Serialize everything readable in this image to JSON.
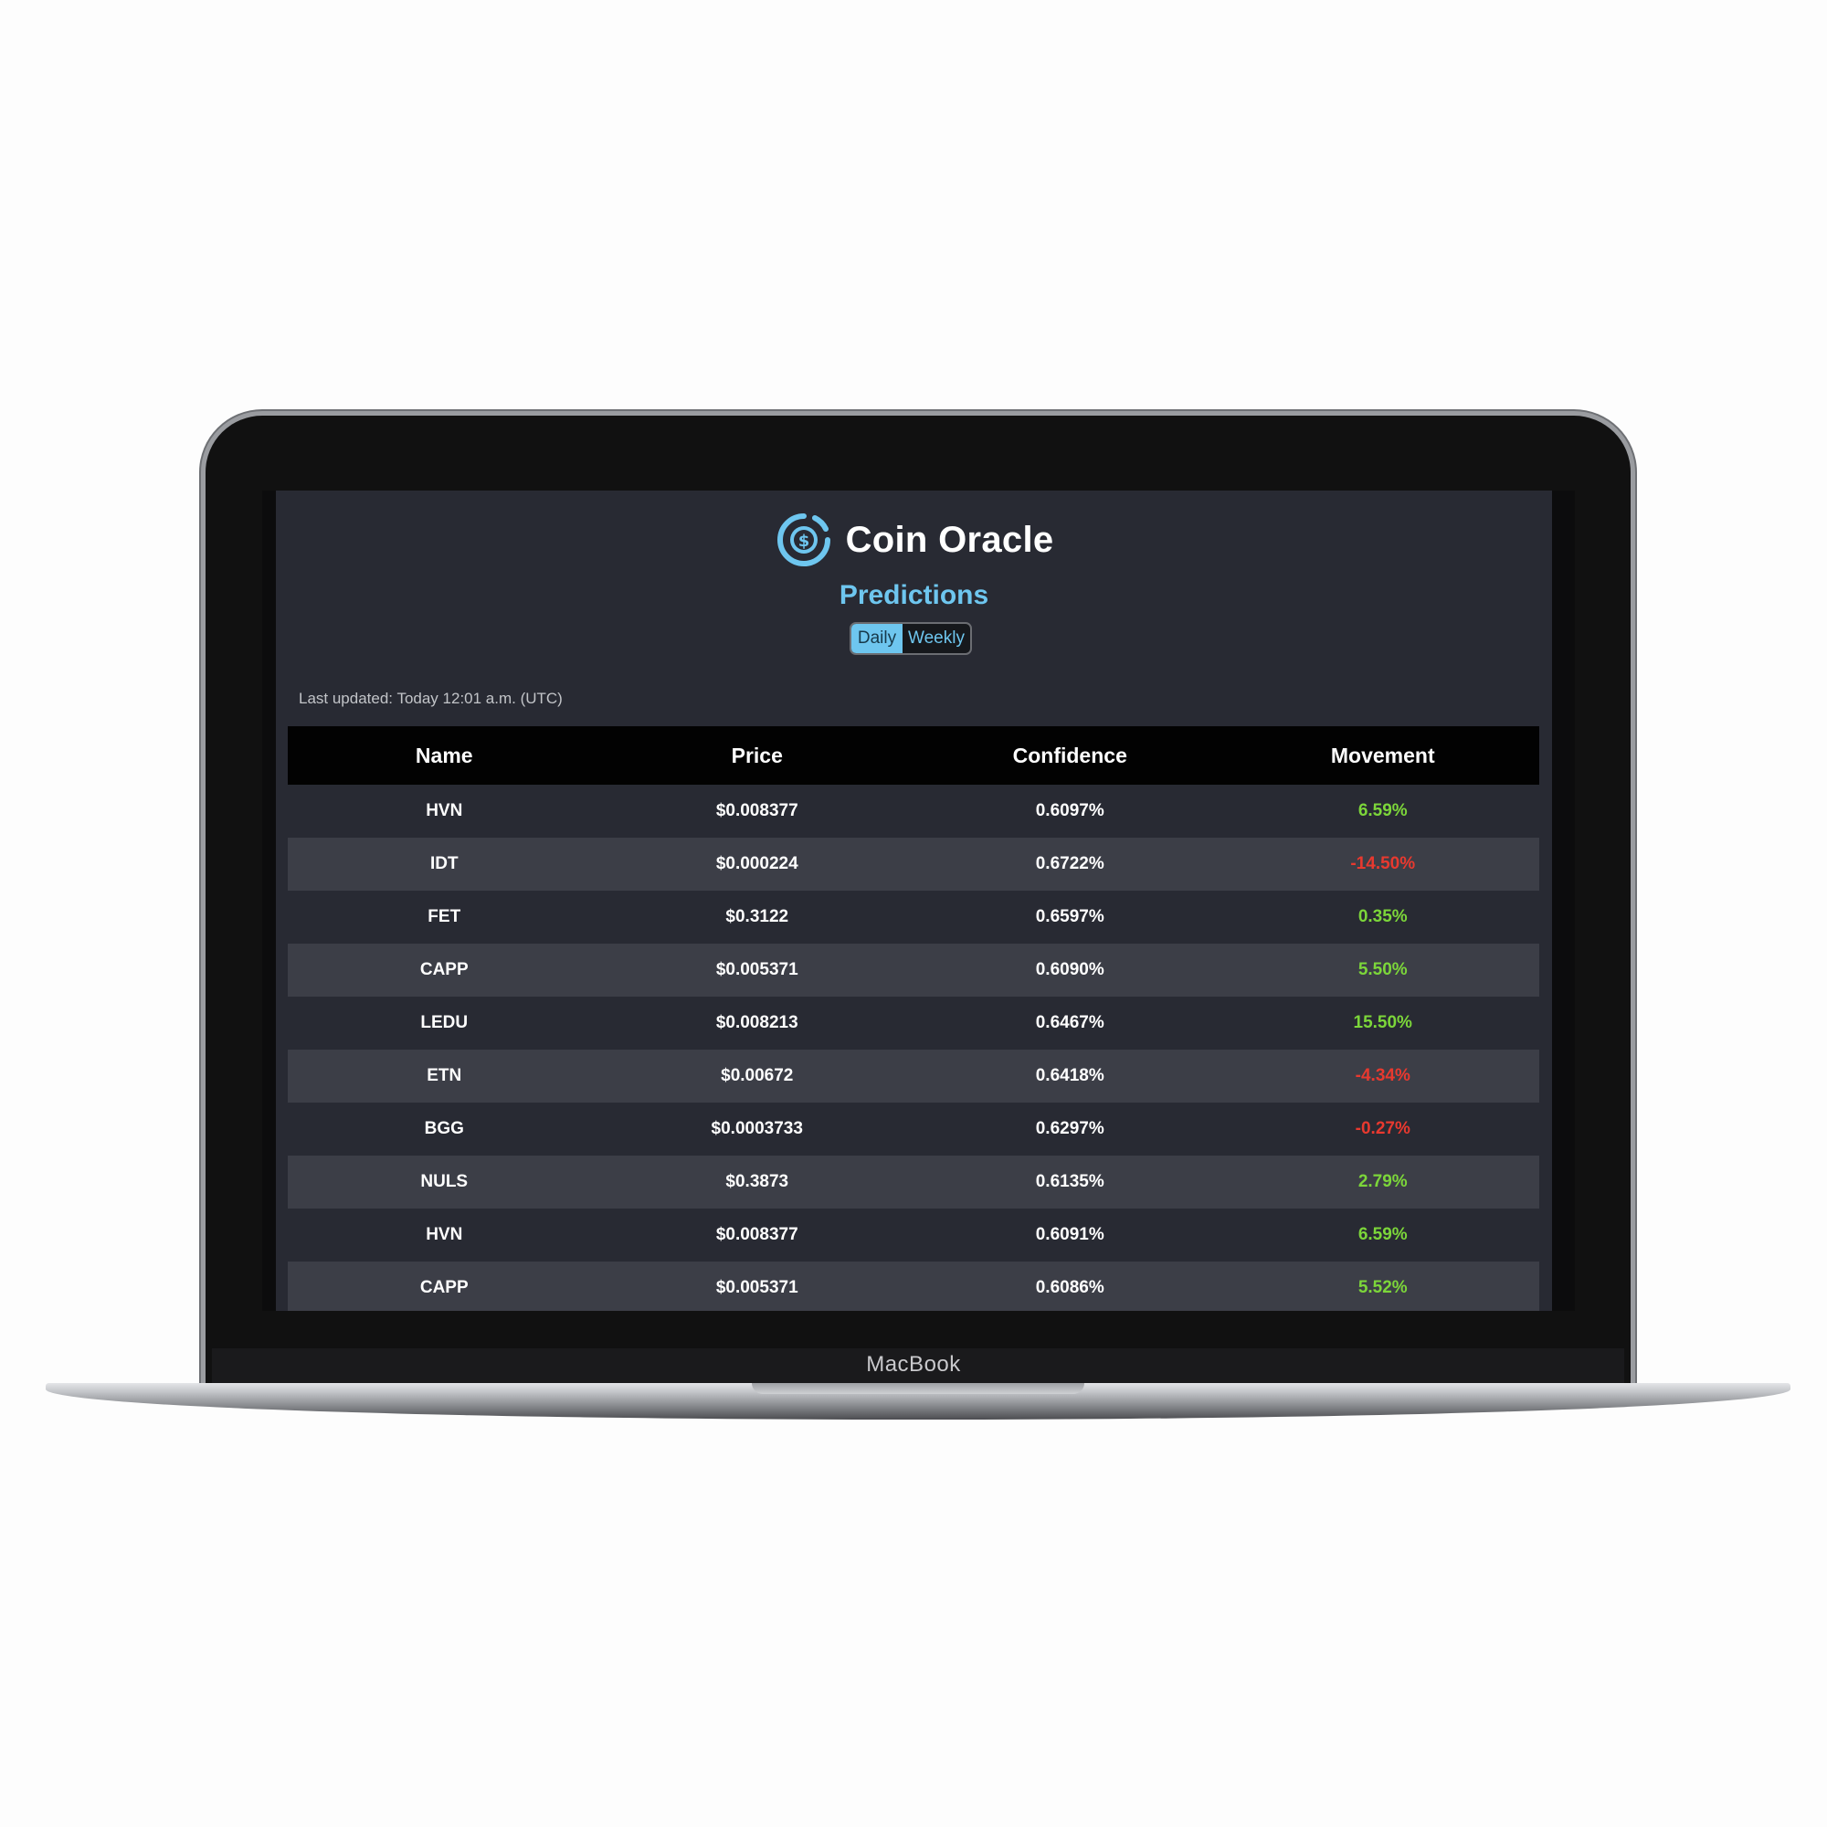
{
  "device": {
    "brand": "MacBook"
  },
  "header": {
    "app_title": "Coin Oracle",
    "logo_icon": "coin-dollar-icon",
    "accent_color": "#6ec6ef"
  },
  "page": {
    "title": "Predictions"
  },
  "period_toggle": {
    "options": [
      "Daily",
      "Weekly"
    ],
    "selected": "Daily"
  },
  "last_updated": "Last updated: Today 12:01 a.m. (UTC)",
  "table": {
    "columns": [
      "Name",
      "Price",
      "Confidence",
      "Movement"
    ],
    "rows": [
      {
        "name": "HVN",
        "price": "$0.008377",
        "confidence": "0.6097%",
        "movement": "6.59%",
        "direction": "up"
      },
      {
        "name": "IDT",
        "price": "$0.000224",
        "confidence": "0.6722%",
        "movement": "-14.50%",
        "direction": "down"
      },
      {
        "name": "FET",
        "price": "$0.3122",
        "confidence": "0.6597%",
        "movement": "0.35%",
        "direction": "up"
      },
      {
        "name": "CAPP",
        "price": "$0.005371",
        "confidence": "0.6090%",
        "movement": "5.50%",
        "direction": "up"
      },
      {
        "name": "LEDU",
        "price": "$0.008213",
        "confidence": "0.6467%",
        "movement": "15.50%",
        "direction": "up"
      },
      {
        "name": "ETN",
        "price": "$0.00672",
        "confidence": "0.6418%",
        "movement": "-4.34%",
        "direction": "down"
      },
      {
        "name": "BGG",
        "price": "$0.0003733",
        "confidence": "0.6297%",
        "movement": "-0.27%",
        "direction": "down"
      },
      {
        "name": "NULS",
        "price": "$0.3873",
        "confidence": "0.6135%",
        "movement": "2.79%",
        "direction": "up"
      },
      {
        "name": "HVN",
        "price": "$0.008377",
        "confidence": "0.6091%",
        "movement": "6.59%",
        "direction": "up"
      },
      {
        "name": "CAPP",
        "price": "$0.005371",
        "confidence": "0.6086%",
        "movement": "5.52%",
        "direction": "up"
      }
    ],
    "colors": {
      "up": "#7cd63a",
      "down": "#e8392f"
    }
  }
}
